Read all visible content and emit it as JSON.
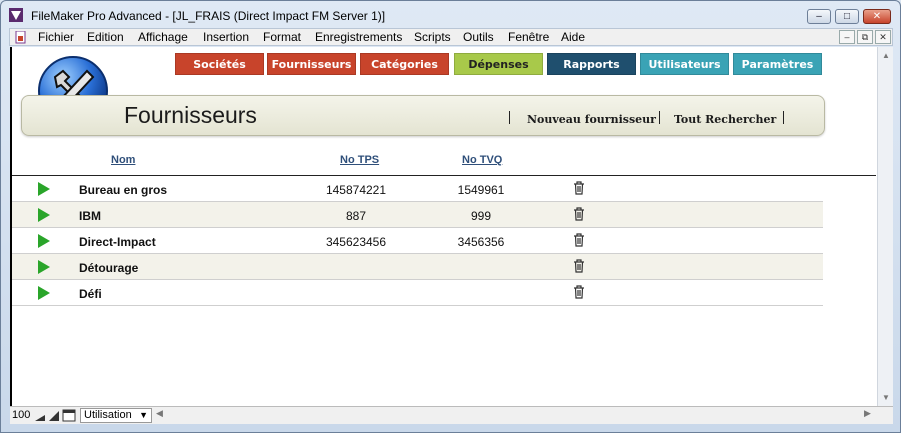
{
  "window": {
    "title": "FileMaker Pro Advanced - [JL_FRAIS (Direct Impact FM Server 1)]",
    "controls": {
      "minimize": "–",
      "maximize": "□",
      "close": "✕"
    }
  },
  "menubar": {
    "items": [
      "Fichier",
      "Edition",
      "Affichage",
      "Insertion",
      "Format",
      "Enregistrements",
      "Scripts",
      "Outils",
      "Fenêtre",
      "Aide"
    ],
    "mdi": {
      "minimize": "–",
      "restore": "⧉",
      "close": "✕"
    }
  },
  "nav_tabs": [
    {
      "label": "Sociétés",
      "color": "#c8442b"
    },
    {
      "label": "Fournisseurs",
      "color": "#c8442b"
    },
    {
      "label": "Catégories",
      "color": "#c8442b"
    },
    {
      "label": "Dépenses",
      "color": "#a8c94a"
    },
    {
      "label": "Rapports",
      "color": "#1f4f6e"
    },
    {
      "label": "Utilisateurs",
      "color": "#3aa3b5"
    },
    {
      "label": "Paramètres",
      "color": "#3aa3b5"
    }
  ],
  "header": {
    "title": "Fournisseurs",
    "links": [
      "Nouveau fournisseur",
      "Tout Rechercher"
    ]
  },
  "table": {
    "columns": {
      "name": "Nom",
      "tps": "No TPS",
      "tvq": "No TVQ"
    },
    "rows": [
      {
        "name": "Bureau en gros",
        "tps": "145874221",
        "tvq": "1549961"
      },
      {
        "name": "IBM",
        "tps": "887",
        "tvq": "999"
      },
      {
        "name": "Direct-Impact",
        "tps": "345623456",
        "tvq": "3456356"
      },
      {
        "name": "Détourage",
        "tps": "",
        "tvq": ""
      },
      {
        "name": "Défi",
        "tps": "",
        "tvq": ""
      }
    ]
  },
  "statusbar": {
    "zoom": "100",
    "mode": "Utilisation"
  }
}
